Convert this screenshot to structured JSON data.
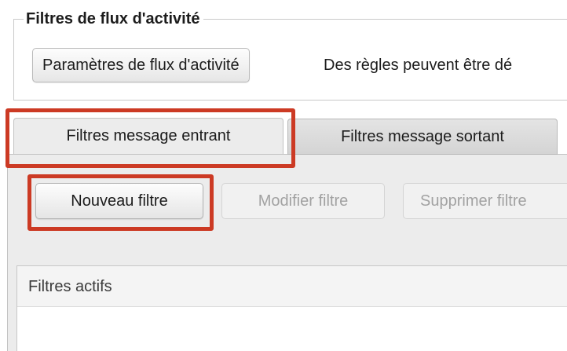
{
  "activity_filters": {
    "legend": "Filtres de flux d'activité",
    "settings_button_label": "Paramètres de flux d'activité",
    "description": "Des règles peuvent être dé"
  },
  "tabs": [
    {
      "label": "Filtres message entrant",
      "selected": true
    },
    {
      "label": "Filtres message sortant",
      "selected": false
    }
  ],
  "filter_actions": {
    "new_label": "Nouveau filtre",
    "edit_label": "Modifier filtre",
    "delete_label": "Supprimer filtre"
  },
  "active_filters": {
    "header": "Filtres actifs"
  },
  "colors": {
    "highlight": "#cc3a24",
    "panel_bg": "#ececec",
    "disabled_text": "#a2a2a2"
  }
}
